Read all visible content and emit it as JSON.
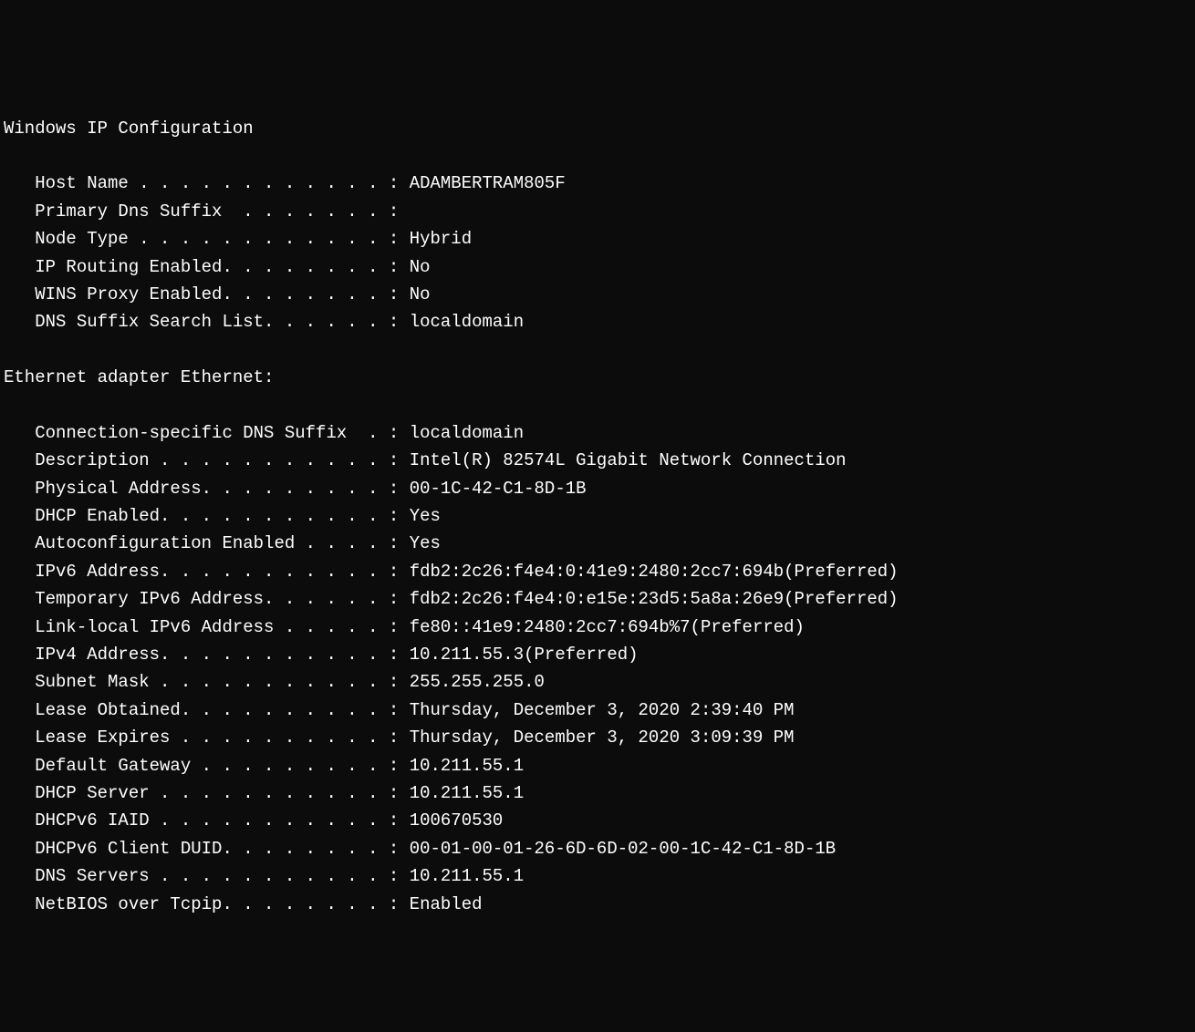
{
  "section1_title": "Windows IP Configuration",
  "section1": {
    "host_name": {
      "label": "   Host Name . . . . . . . . . . . . : ",
      "value": "ADAMBERTRAM805F"
    },
    "primary_dns_suffix": {
      "label": "   Primary Dns Suffix  . . . . . . . :",
      "value": ""
    },
    "node_type": {
      "label": "   Node Type . . . . . . . . . . . . : ",
      "value": "Hybrid"
    },
    "ip_routing_enabled": {
      "label": "   IP Routing Enabled. . . . . . . . : ",
      "value": "No"
    },
    "wins_proxy_enabled": {
      "label": "   WINS Proxy Enabled. . . . . . . . : ",
      "value": "No"
    },
    "dns_suffix_search_list": {
      "label": "   DNS Suffix Search List. . . . . . : ",
      "value": "localdomain"
    }
  },
  "section2_title": "Ethernet adapter Ethernet:",
  "section2": {
    "conn_dns_suffix": {
      "label": "   Connection-specific DNS Suffix  . : ",
      "value": "localdomain"
    },
    "description": {
      "label": "   Description . . . . . . . . . . . : ",
      "value": "Intel(R) 82574L Gigabit Network Connection"
    },
    "physical_address": {
      "label": "   Physical Address. . . . . . . . . : ",
      "value": "00-1C-42-C1-8D-1B"
    },
    "dhcp_enabled": {
      "label": "   DHCP Enabled. . . . . . . . . . . : ",
      "value": "Yes"
    },
    "autoconfig_enabled": {
      "label": "   Autoconfiguration Enabled . . . . : ",
      "value": "Yes"
    },
    "ipv6_address": {
      "label": "   IPv6 Address. . . . . . . . . . . : ",
      "value": "fdb2:2c26:f4e4:0:41e9:2480:2cc7:694b(Preferred)"
    },
    "temp_ipv6_address": {
      "label": "   Temporary IPv6 Address. . . . . . : ",
      "value": "fdb2:2c26:f4e4:0:e15e:23d5:5a8a:26e9(Preferred)"
    },
    "link_local_ipv6": {
      "label": "   Link-local IPv6 Address . . . . . : ",
      "value": "fe80::41e9:2480:2cc7:694b%7(Preferred)"
    },
    "ipv4_address": {
      "label": "   IPv4 Address. . . . . . . . . . . : ",
      "value": "10.211.55.3(Preferred)"
    },
    "subnet_mask": {
      "label": "   Subnet Mask . . . . . . . . . . . : ",
      "value": "255.255.255.0"
    },
    "lease_obtained": {
      "label": "   Lease Obtained. . . . . . . . . . : ",
      "value": "Thursday, December 3, 2020 2:39:40 PM"
    },
    "lease_expires": {
      "label": "   Lease Expires . . . . . . . . . . : ",
      "value": "Thursday, December 3, 2020 3:09:39 PM"
    },
    "default_gateway": {
      "label": "   Default Gateway . . . . . . . . . : ",
      "value": "10.211.55.1"
    },
    "dhcp_server": {
      "label": "   DHCP Server . . . . . . . . . . . : ",
      "value": "10.211.55.1"
    },
    "dhcpv6_iaid": {
      "label": "   DHCPv6 IAID . . . . . . . . . . . : ",
      "value": "100670530"
    },
    "dhcpv6_client_duid": {
      "label": "   DHCPv6 Client DUID. . . . . . . . : ",
      "value": "00-01-00-01-26-6D-6D-02-00-1C-42-C1-8D-1B"
    },
    "dns_servers": {
      "label": "   DNS Servers . . . . . . . . . . . : ",
      "value": "10.211.55.1"
    },
    "netbios_over_tcpip": {
      "label": "   NetBIOS over Tcpip. . . . . . . . : ",
      "value": "Enabled"
    }
  }
}
